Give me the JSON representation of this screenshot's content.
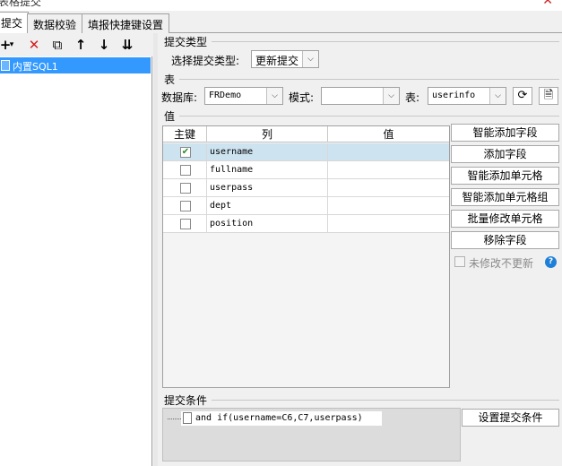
{
  "window": {
    "title": "表格提交"
  },
  "tabs": [
    {
      "label": "提交",
      "active": true
    },
    {
      "label": "数据校验",
      "active": false
    },
    {
      "label": "填报快捷键设置",
      "active": false
    }
  ],
  "left_panel": {
    "toolbar": {
      "add_icon": "+",
      "add_dropdown": "▾",
      "delete_icon": "✕",
      "copy_icon": "⧉",
      "up_icon": "↑",
      "down_icon": "↓",
      "sort_icon": "⇊"
    },
    "tree": [
      {
        "label": "内置SQL1",
        "selected": true
      }
    ]
  },
  "submit_type": {
    "section_label": "提交类型",
    "select_label": "选择提交类型:",
    "selected": "更新提交"
  },
  "table_section": {
    "section_label": "表",
    "db_label": "数据库:",
    "db_value": "FRDemo",
    "schema_label": "模式:",
    "schema_value": "",
    "table_label": "表:",
    "table_value": "userinfo"
  },
  "values_section": {
    "section_label": "值",
    "columns": [
      "主键",
      "列",
      "值"
    ],
    "rows": [
      {
        "key": true,
        "column": "username",
        "value": ""
      },
      {
        "key": false,
        "column": "fullname",
        "value": ""
      },
      {
        "key": false,
        "column": "userpass",
        "value": ""
      },
      {
        "key": false,
        "column": "dept",
        "value": ""
      },
      {
        "key": false,
        "column": "position",
        "value": ""
      }
    ],
    "buttons": {
      "smart_add_field": "智能添加字段",
      "add_field": "添加字段",
      "smart_add_cell": "智能添加单元格",
      "smart_add_cell_group": "智能添加单元格组",
      "batch_edit_cell": "批量修改单元格",
      "remove_field": "移除字段"
    },
    "no_update_unmodified": "未修改不更新"
  },
  "condition_section": {
    "section_label": "提交条件",
    "condition_text": "and if(username=C6,C7,userpass)",
    "set_button": "设置提交条件"
  },
  "colors": {
    "selection": "#3399ff",
    "row_selected": "#cde3f0",
    "help": "#1e7fd8"
  }
}
